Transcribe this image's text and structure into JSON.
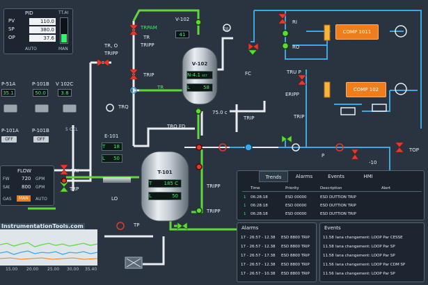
{
  "pid_panel": {
    "title": "PID",
    "rows": [
      {
        "label": "PV",
        "value": "110.0"
      },
      {
        "label": "SP",
        "value": "380.0"
      },
      {
        "label": "OP",
        "value": "37.6"
      }
    ],
    "mode_label": "AUTO",
    "tag": "TT.AI",
    "man_label": "MAN"
  },
  "pumps": [
    {
      "tag": "P-51A",
      "value": "35.1",
      "name": "P-101A",
      "state": "OFF"
    },
    {
      "tag": "P-101B",
      "value": "50.0",
      "name": "P-101B",
      "state": "OFF"
    },
    {
      "tag": "V 102C",
      "value": "3.8"
    }
  ],
  "flow_panel": {
    "title": "FLOW",
    "rows": [
      {
        "label": "FW",
        "value": "720",
        "unit": "GPM"
      },
      {
        "label": "SAt",
        "value": "800",
        "unit": "GPM"
      }
    ],
    "modes": [
      "GAS",
      "MAN",
      "AUTO"
    ]
  },
  "trend_mini": {
    "watermark": "InstrumentationTools.com",
    "x_ticks": [
      "15.00",
      "20.00",
      "25.00",
      "30.00",
      "35.40"
    ]
  },
  "vessels": {
    "v102": {
      "name": "V-102",
      "level_label": "N-4.1",
      "level_unit": "scr",
      "l_label": "L",
      "l_value": "58"
    },
    "t101": {
      "name": "T-101",
      "temp_label": "T",
      "temp_value": "185 C",
      "l_label": "L",
      "l_value": "50"
    },
    "e101": {
      "name": "E-101",
      "t_label": "T",
      "t_value": "18",
      "l_label": "L",
      "l_value": "50"
    }
  },
  "tags": {
    "v102_top": "V-102",
    "v102_top_val": "41",
    "trpam": "TRPAM",
    "tr1": "TR",
    "tripp1": "TRIPP",
    "tro": "TR, O",
    "tripp2": "TRIPP",
    "trip1": "TRIP",
    "tr_valve": "TR",
    "trq": "TRQ",
    "tro_fd": "TRO FD",
    "fii": "FII",
    "fc": "FC",
    "trp": "TRU P",
    "erpp": "ERIPP",
    "trip2": "TRIP",
    "trip3": "TRIP",
    "v75": "75.0 c",
    "ri": "RI",
    "ro": "RO",
    "top": "TOP",
    "minus10": "-10",
    "p_label": "P",
    "tripp3": "TRIPP",
    "tripp4": "TRIPP",
    "tri": "TRI",
    "trp_left": "TRP",
    "lo": "LO",
    "tp": "TP",
    "ocl": "5 OCL"
  },
  "compressors": [
    {
      "label": "COMP 1011"
    },
    {
      "label": "COMP 102"
    }
  ],
  "tabs": [
    "Trends",
    "Alarms",
    "Events",
    "HMI"
  ],
  "trip_table": {
    "headers": [
      "Time",
      "Priority",
      "Description",
      "Alert"
    ],
    "rows": [
      {
        "n": "1",
        "time": "06:28:18",
        "priority": "ESD 00000",
        "desc": "ESD DUTTION TRIP"
      },
      {
        "n": "1",
        "time": "06:28:18",
        "priority": "ESD 00000",
        "desc": "ESD DUTTION TRIP"
      },
      {
        "n": "1",
        "time": "06:28:18",
        "priority": "ESD 00000",
        "desc": "ESD DUTTION TRIP"
      }
    ]
  },
  "alarms_log": {
    "title": "Alarms",
    "rows": [
      {
        "time": "17 - 26:57 - 12.38",
        "text": "ESD 8800 TRIP"
      },
      {
        "time": "17 - 26:57 - 12.38",
        "text": "ESD 8800 TRIP"
      },
      {
        "time": "17 - 26:57 - 17.38",
        "text": "ESD 8800 TRIP"
      },
      {
        "time": "17 - 26:57 - 12.38",
        "text": "ESD 8800 TRIP"
      },
      {
        "time": "17 - 26:57 - 10.38",
        "text": "ESD 8800 TRIP"
      }
    ]
  },
  "events_log": {
    "title": "Events",
    "rows": [
      {
        "time": "11.58",
        "text": "Iana changement: LOOP Par CESSE"
      },
      {
        "time": "11.58",
        "text": "Iana changement: LOOP Par SP"
      },
      {
        "time": "11.58",
        "text": "Iana changement: LOOP Par SP"
      },
      {
        "time": "11.56",
        "text": "Iana changement: LOOP Par CDM SP"
      },
      {
        "time": "11.56",
        "text": "Iana changement: LOOP Par SP"
      }
    ]
  },
  "colors": {
    "background": "#2a3440",
    "pipe_white": "#e9edf1",
    "pipe_green": "#5fd83a",
    "pipe_blue": "#3fa7e6",
    "valve_red": "#e23a2e",
    "accent_orange": "#f07d1c",
    "display_green": "#38f070"
  }
}
